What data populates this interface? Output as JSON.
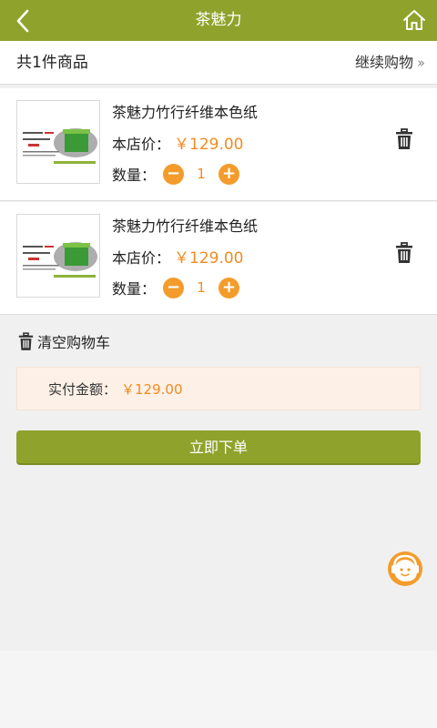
{
  "header": {
    "title": "茶魅力",
    "back_icon": "chevron-left-icon",
    "home_icon": "home-icon"
  },
  "summary": {
    "count_text": "共1件商品",
    "continue_label": "继续购物"
  },
  "items": [
    {
      "name": "茶魅力竹行纤维本色纸",
      "price_label": "本店价：",
      "price": "￥129.00",
      "qty_label": "数量：",
      "qty": "1"
    },
    {
      "name": "茶魅力竹行纤维本色纸",
      "price_label": "本店价：",
      "price": "￥129.00",
      "qty_label": "数量：",
      "qty": "1"
    }
  ],
  "cart": {
    "clear_label": "清空购物车"
  },
  "total": {
    "label": "实付金额：",
    "amount": "￥129.00"
  },
  "order": {
    "label": "立即下单"
  },
  "colors": {
    "brand": "#8fa32c",
    "accent": "#f39c2c",
    "price": "#f08c20",
    "total_bg": "#fdf0e6"
  }
}
